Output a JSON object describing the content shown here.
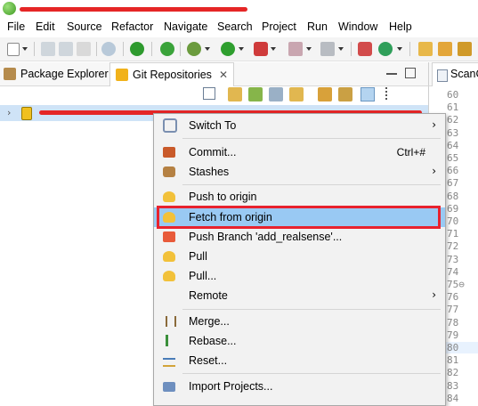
{
  "menubar": [
    "File",
    "Edit",
    "Source",
    "Refactor",
    "Navigate",
    "Search",
    "Project",
    "Run",
    "Window",
    "Help"
  ],
  "tabs": [
    {
      "label": "Package Explorer",
      "icon": "package-explorer-icon"
    },
    {
      "label": "Git Repositories",
      "icon": "git-repositories-icon",
      "close": "✕"
    }
  ],
  "editor": {
    "tab_label": "ScanC",
    "line_numbers": [
      "60",
      "61",
      "62",
      "63",
      "64",
      "65",
      "66",
      "67",
      "68",
      "69",
      "70",
      "71",
      "72",
      "73",
      "74",
      "75⊖",
      "76",
      "77",
      "78",
      "79",
      "80",
      "81",
      "82",
      "83",
      "84"
    ]
  },
  "context_menu": {
    "items": [
      {
        "label": "Switch To",
        "icon": "switch-to-icon",
        "submenu": "›"
      },
      {
        "label": "Commit...",
        "icon": "commit-icon",
        "accelerator": "Ctrl+#"
      },
      {
        "label": "Stashes",
        "icon": "stashes-icon",
        "submenu": "›"
      },
      {
        "label": "Push to origin",
        "icon": "push-icon"
      },
      {
        "label": "Fetch from origin",
        "icon": "fetch-icon",
        "highlighted": true
      },
      {
        "label": "Push Branch 'add_realsense'...",
        "icon": "push-branch-icon"
      },
      {
        "label": "Pull",
        "icon": "pull-icon"
      },
      {
        "label": "Pull...",
        "icon": "pull-dialog-icon"
      },
      {
        "label": "Remote",
        "submenu": "›"
      },
      {
        "label": "Merge...",
        "icon": "merge-icon"
      },
      {
        "label": "Rebase...",
        "icon": "rebase-icon"
      },
      {
        "label": "Reset...",
        "icon": "reset-icon"
      },
      {
        "label": "Import Projects...",
        "icon": "import-projects-icon"
      }
    ]
  },
  "colors": {
    "selection": "#99c9f3",
    "annotation_red": "#e8222e",
    "tree_selected": "#cfe3f7"
  }
}
